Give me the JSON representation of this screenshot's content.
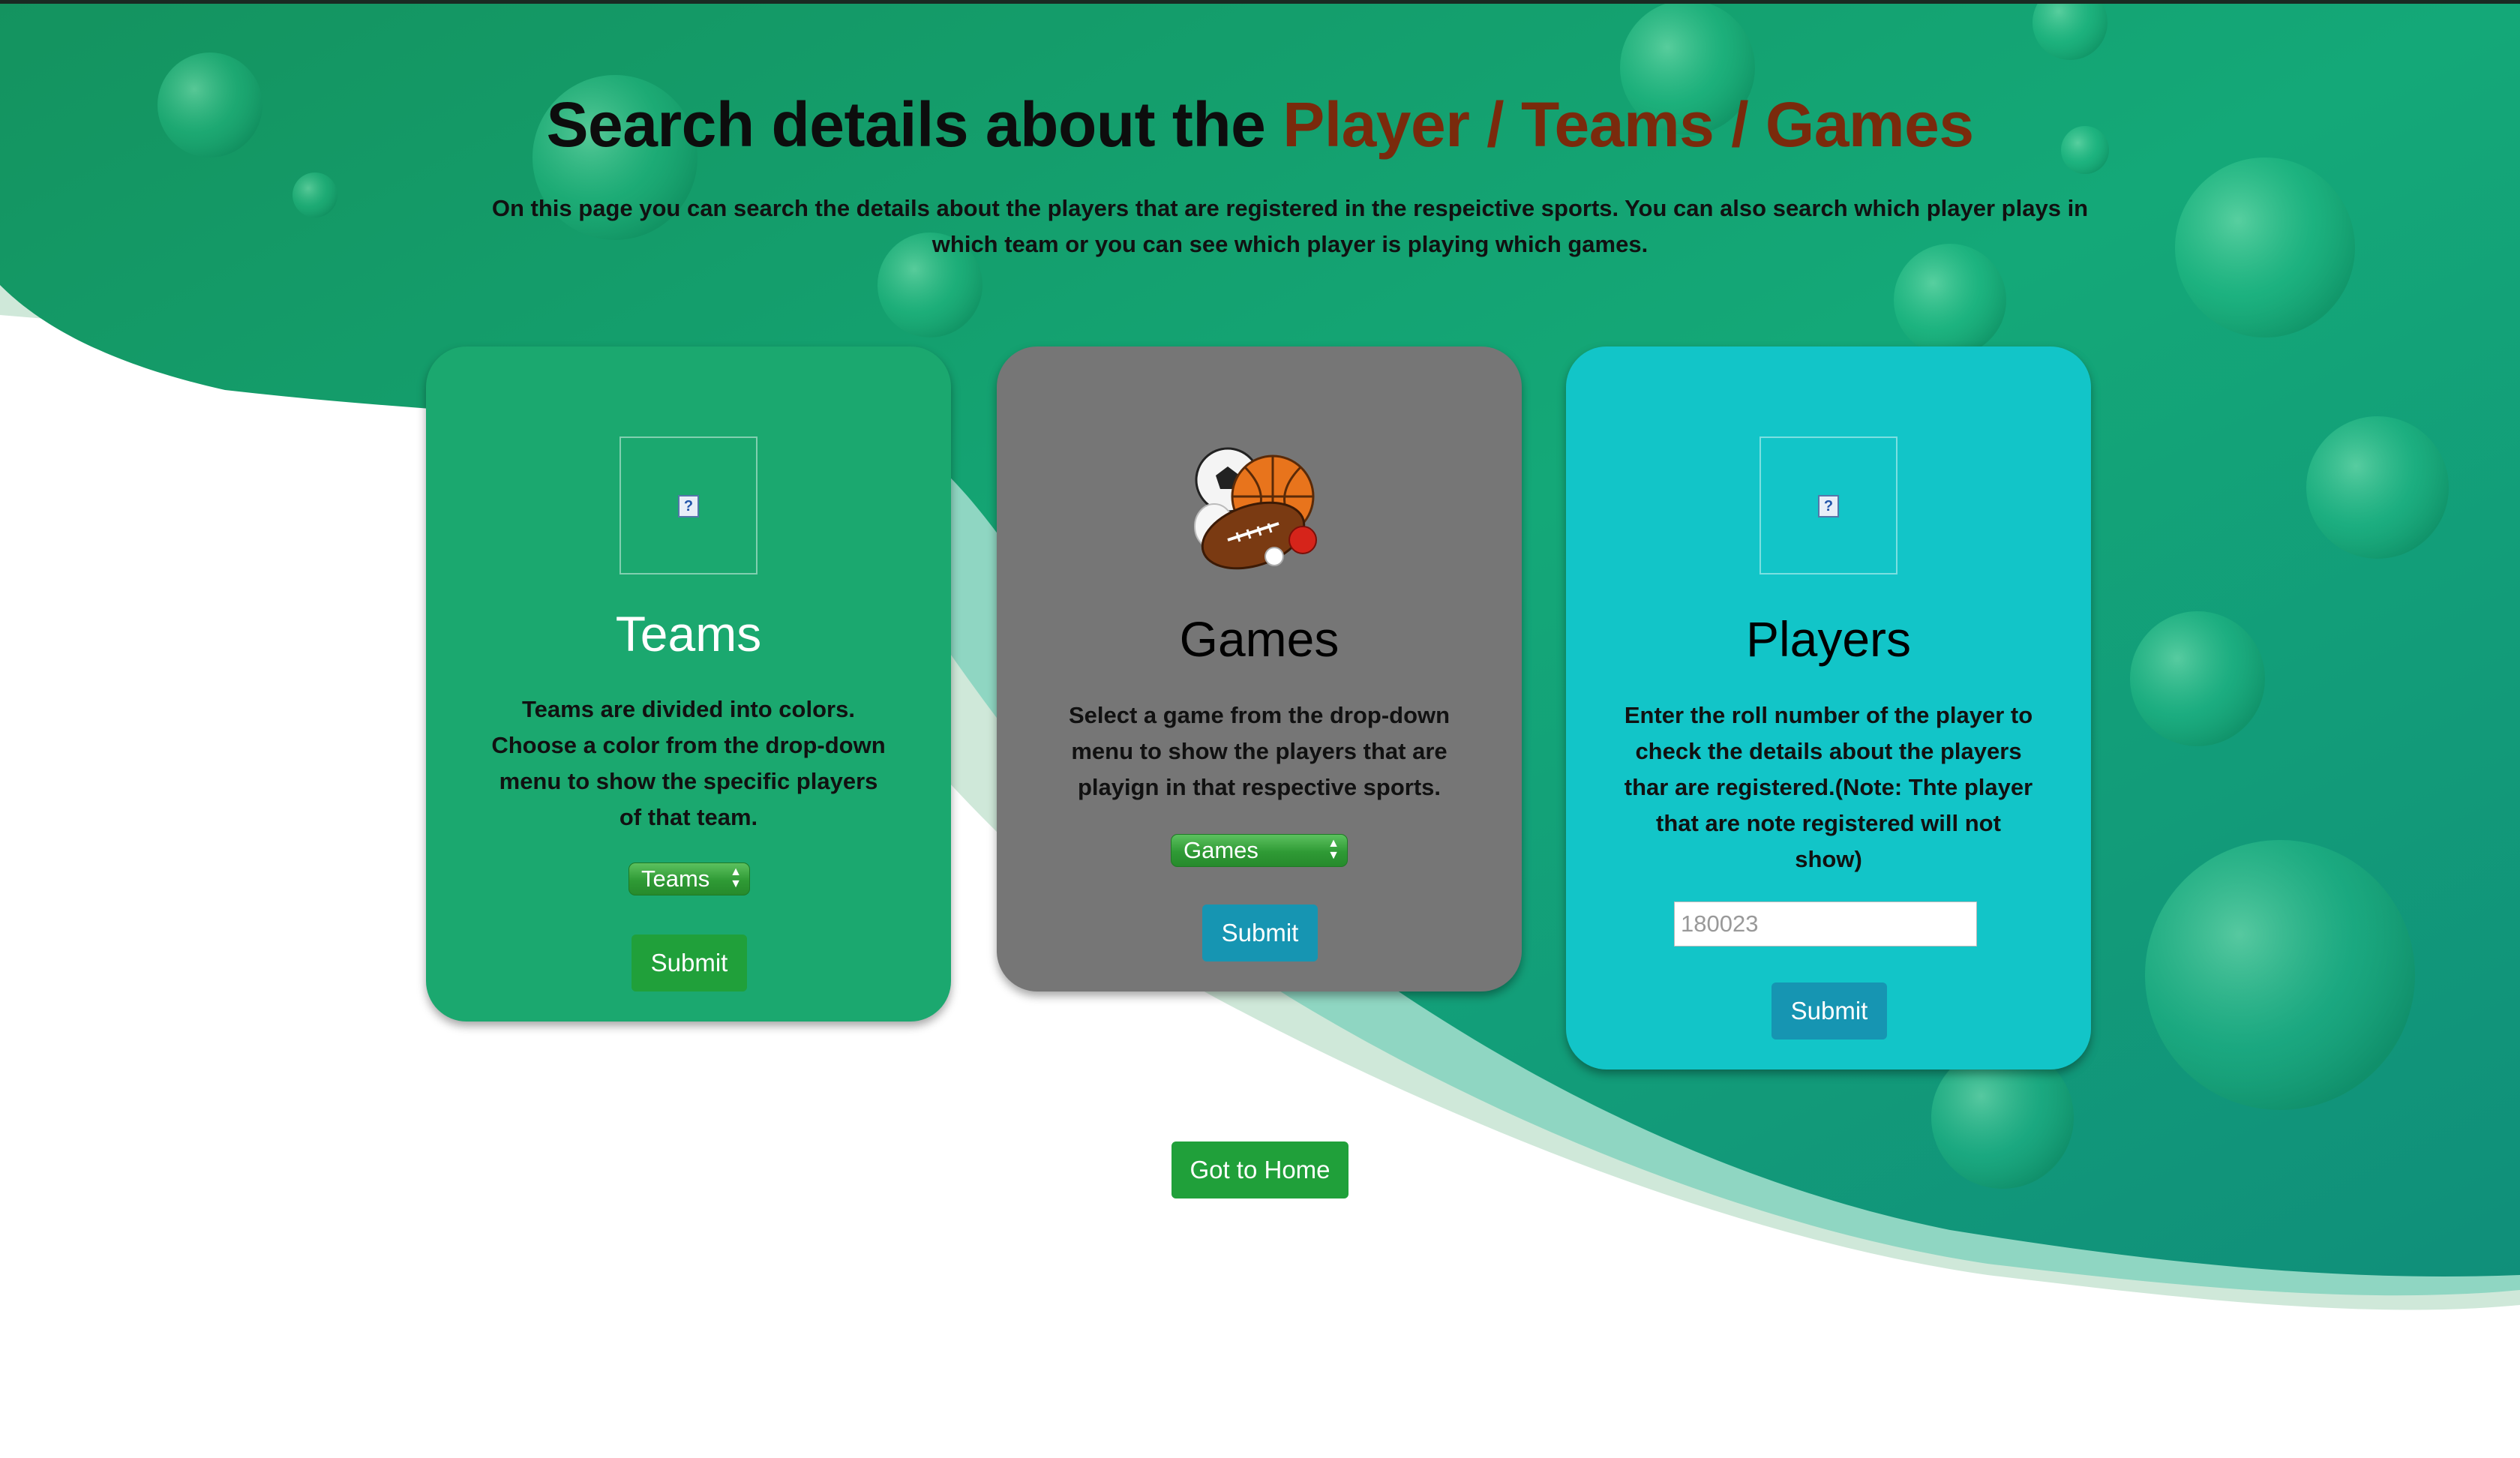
{
  "page": {
    "heading_plain": "Search details about the ",
    "heading_accent": "Player / Teams / Games",
    "intro": "On this page you can search the details about the players that are registered in the respeictive sports. You can also search which player plays in which team or you can see which player is playing which games."
  },
  "cards": {
    "teams": {
      "title": "Teams",
      "description": "Teams are divided into colors. Choose a color from the drop-down menu to show the specific players of that team.",
      "select_value": "Teams",
      "submit_label": "Submit",
      "image_icon": "broken-image-icon"
    },
    "games": {
      "title": "Games",
      "description": "Select a game from the drop-down menu to show the players that are playign in that respective sports.",
      "select_value": "Games",
      "submit_label": "Submit",
      "image_icon": "sports-balls-icon"
    },
    "players": {
      "title": "Players",
      "description": "Enter the roll number of the player to check the details about the players thar are registered.(Note: Thte player that are note registered will not show)",
      "input_placeholder": "180023",
      "submit_label": "Submit",
      "image_icon": "broken-image-icon"
    }
  },
  "home_button_label": "Got to Home",
  "colors": {
    "heading_accent": "#7a2a0c",
    "teams_card": "#1ba86f",
    "games_card": "#767676",
    "players_card": "#12c5c8",
    "green_button": "#20a03a",
    "teal_button": "#1695b2"
  }
}
